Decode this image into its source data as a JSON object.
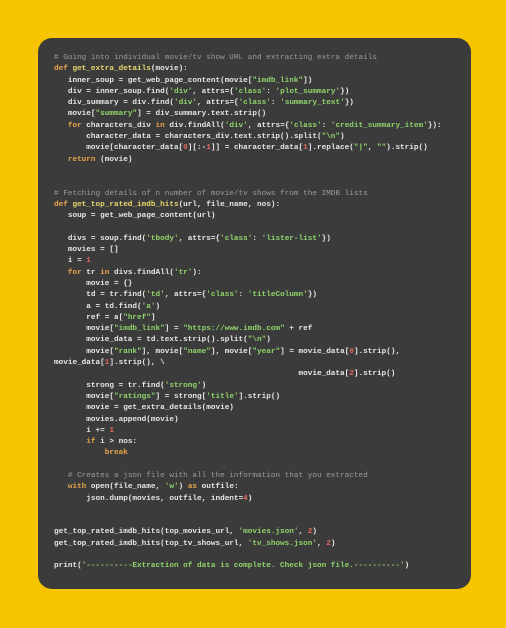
{
  "colors": {
    "background": "#f6c500",
    "panel": "#3b3b3b",
    "comment": "#9b9b9b",
    "keyword": "#e9a54a",
    "function": "#e8d66c",
    "string": "#8fd46a",
    "number": "#e36a5e",
    "text": "#e6e6e6"
  },
  "code_lines": [
    [
      [
        "c",
        "# Going into individual movie/tv show URL and extracting extra details"
      ]
    ],
    [
      [
        "k",
        "def "
      ],
      [
        "f",
        "get_extra_details"
      ],
      [
        "d",
        "(movie):"
      ]
    ],
    [
      [
        "d",
        "   inner_soup = get_web_page_content(movie["
      ],
      [
        "s",
        "\"imdb_link\""
      ],
      [
        "d",
        "])"
      ]
    ],
    [
      [
        "d",
        "   div = inner_soup.find("
      ],
      [
        "s",
        "'div'"
      ],
      [
        "d",
        ", attrs={"
      ],
      [
        "s",
        "'class'"
      ],
      [
        "d",
        ": "
      ],
      [
        "s",
        "'plot_summary'"
      ],
      [
        "d",
        "})"
      ]
    ],
    [
      [
        "d",
        "   div_summary = div.find("
      ],
      [
        "s",
        "'div'"
      ],
      [
        "d",
        ", attrs={"
      ],
      [
        "s",
        "'class'"
      ],
      [
        "d",
        ": "
      ],
      [
        "s",
        "'summary_text'"
      ],
      [
        "d",
        "})"
      ]
    ],
    [
      [
        "d",
        "   movie["
      ],
      [
        "s",
        "\"summary\""
      ],
      [
        "d",
        "] = div_summary.text.strip()"
      ]
    ],
    [
      [
        "d",
        "   "
      ],
      [
        "k",
        "for"
      ],
      [
        "d",
        " characters_div "
      ],
      [
        "k",
        "in"
      ],
      [
        "d",
        " div.findAll("
      ],
      [
        "s",
        "'div'"
      ],
      [
        "d",
        ", attrs={"
      ],
      [
        "s",
        "'class'"
      ],
      [
        "d",
        ": "
      ],
      [
        "s",
        "'credit_summary_item'"
      ],
      [
        "d",
        "}):"
      ]
    ],
    [
      [
        "d",
        "       character_data = characters_div.text.strip().split("
      ],
      [
        "s",
        "\"\\n\""
      ],
      [
        "d",
        ")"
      ]
    ],
    [
      [
        "d",
        "       movie[character_data["
      ],
      [
        "n",
        "0"
      ],
      [
        "d",
        "][:-"
      ],
      [
        "n",
        "1"
      ],
      [
        "d",
        "]] = character_data["
      ],
      [
        "n",
        "1"
      ],
      [
        "d",
        "].replace("
      ],
      [
        "s",
        "\"|\""
      ],
      [
        "d",
        ", "
      ],
      [
        "s",
        "\"\""
      ],
      [
        "d",
        ").strip()"
      ]
    ],
    [
      [
        "d",
        "   "
      ],
      [
        "k",
        "return"
      ],
      [
        "d",
        " (movie)"
      ]
    ],
    [],
    [],
    [
      [
        "c",
        "# Fetching details of n number of movie/tv shows from the IMDB lists"
      ]
    ],
    [
      [
        "k",
        "def "
      ],
      [
        "f",
        "get_top_rated_imdb_hits"
      ],
      [
        "d",
        "(url, file_name, nos):"
      ]
    ],
    [
      [
        "d",
        "   soup = get_web_page_content(url)"
      ]
    ],
    [],
    [
      [
        "d",
        "   divs = soup.find("
      ],
      [
        "s",
        "'tbody'"
      ],
      [
        "d",
        ", attrs={"
      ],
      [
        "s",
        "'class'"
      ],
      [
        "d",
        ": "
      ],
      [
        "s",
        "'lister-list'"
      ],
      [
        "d",
        "})"
      ]
    ],
    [
      [
        "d",
        "   movies = []"
      ]
    ],
    [
      [
        "d",
        "   i = "
      ],
      [
        "n",
        "1"
      ]
    ],
    [
      [
        "d",
        "   "
      ],
      [
        "k",
        "for"
      ],
      [
        "d",
        " tr "
      ],
      [
        "k",
        "in"
      ],
      [
        "d",
        " divs.findAll("
      ],
      [
        "s",
        "'tr'"
      ],
      [
        "d",
        "):"
      ]
    ],
    [
      [
        "d",
        "       movie = {}"
      ]
    ],
    [
      [
        "d",
        "       td = tr.find("
      ],
      [
        "s",
        "'td'"
      ],
      [
        "d",
        ", attrs={"
      ],
      [
        "s",
        "'class'"
      ],
      [
        "d",
        ": "
      ],
      [
        "s",
        "'titleColumn'"
      ],
      [
        "d",
        "})"
      ]
    ],
    [
      [
        "d",
        "       a = td.find("
      ],
      [
        "s",
        "'a'"
      ],
      [
        "d",
        ")"
      ]
    ],
    [
      [
        "d",
        "       ref = a["
      ],
      [
        "s",
        "\"href\""
      ],
      [
        "d",
        "]"
      ]
    ],
    [
      [
        "d",
        "       movie["
      ],
      [
        "s",
        "\"imdb_link\""
      ],
      [
        "d",
        "] = "
      ],
      [
        "s",
        "\"https://www.imdb.com\""
      ],
      [
        "d",
        " + ref"
      ]
    ],
    [
      [
        "d",
        "       movie_data = td.text.strip().split("
      ],
      [
        "s",
        "\"\\n\""
      ],
      [
        "d",
        ")"
      ]
    ],
    [
      [
        "d",
        "       movie["
      ],
      [
        "s",
        "\"rank\""
      ],
      [
        "d",
        "], movie["
      ],
      [
        "s",
        "\"name\""
      ],
      [
        "d",
        "], movie["
      ],
      [
        "s",
        "\"year\""
      ],
      [
        "d",
        "] = movie_data["
      ],
      [
        "n",
        "0"
      ],
      [
        "d",
        "].strip(),"
      ]
    ],
    [
      [
        "d",
        "movie_data["
      ],
      [
        "n",
        "1"
      ],
      [
        "d",
        "].strip(), \\"
      ]
    ],
    [
      [
        "d",
        "                                                     movie_data["
      ],
      [
        "n",
        "2"
      ],
      [
        "d",
        "].strip()"
      ]
    ],
    [
      [
        "d",
        "       strong = tr.find("
      ],
      [
        "s",
        "'strong'"
      ],
      [
        "d",
        ")"
      ]
    ],
    [
      [
        "d",
        "       movie["
      ],
      [
        "s",
        "\"ratings\""
      ],
      [
        "d",
        "] = strong["
      ],
      [
        "s",
        "'title'"
      ],
      [
        "d",
        "].strip()"
      ]
    ],
    [
      [
        "d",
        "       movie = get_extra_details(movie)"
      ]
    ],
    [
      [
        "d",
        "       movies.append(movie)"
      ]
    ],
    [
      [
        "d",
        "       i += "
      ],
      [
        "n",
        "1"
      ]
    ],
    [
      [
        "d",
        "       "
      ],
      [
        "k",
        "if"
      ],
      [
        "d",
        " i > nos:"
      ]
    ],
    [
      [
        "d",
        "           "
      ],
      [
        "k",
        "break"
      ]
    ],
    [],
    [
      [
        "d",
        "   "
      ],
      [
        "c",
        "# Creates a json file with all the information that you extracted"
      ]
    ],
    [
      [
        "d",
        "   "
      ],
      [
        "k",
        "with"
      ],
      [
        "d",
        " open(file_name, "
      ],
      [
        "s",
        "'w'"
      ],
      [
        "d",
        ") "
      ],
      [
        "k",
        "as"
      ],
      [
        "d",
        " outfile:"
      ]
    ],
    [
      [
        "d",
        "       json.dump(movies, outfile, indent="
      ],
      [
        "n",
        "4"
      ],
      [
        "d",
        ")"
      ]
    ],
    [],
    [],
    [
      [
        "d",
        "get_top_rated_imdb_hits(top_movies_url, "
      ],
      [
        "s",
        "'movies.json'"
      ],
      [
        "d",
        ", "
      ],
      [
        "n",
        "2"
      ],
      [
        "d",
        ")"
      ]
    ],
    [
      [
        "d",
        "get_top_rated_imdb_hits(top_tv_shows_url, "
      ],
      [
        "s",
        "'tv_shows.json'"
      ],
      [
        "d",
        ", "
      ],
      [
        "n",
        "2"
      ],
      [
        "d",
        ")"
      ]
    ],
    [],
    [
      [
        "d",
        "print("
      ],
      [
        "s",
        "'----------Extraction of data is complete. Check json file.----------'"
      ],
      [
        "d",
        ")"
      ]
    ]
  ]
}
